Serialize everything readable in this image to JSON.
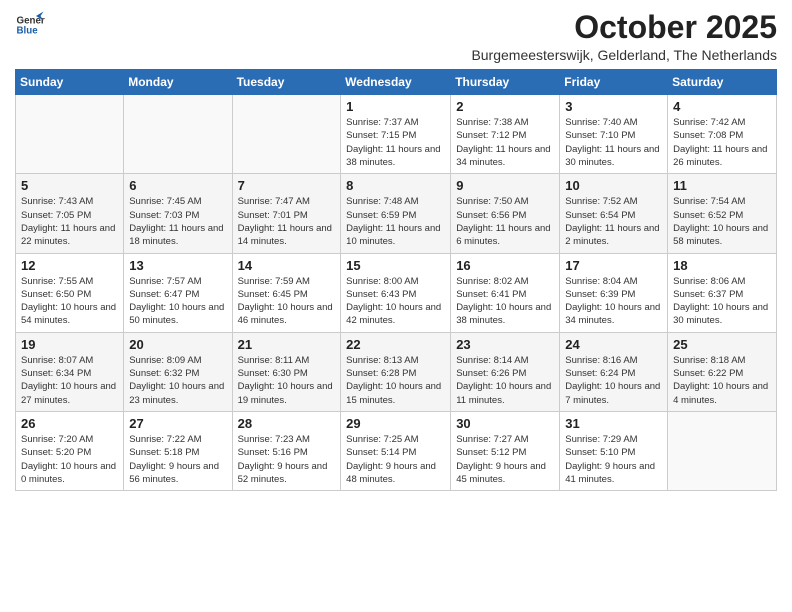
{
  "logo": {
    "line1": "General",
    "line2": "Blue"
  },
  "title": "October 2025",
  "subtitle": "Burgemeesterswijk, Gelderland, The Netherlands",
  "days_of_week": [
    "Sunday",
    "Monday",
    "Tuesday",
    "Wednesday",
    "Thursday",
    "Friday",
    "Saturday"
  ],
  "weeks": [
    [
      {
        "day": "",
        "info": ""
      },
      {
        "day": "",
        "info": ""
      },
      {
        "day": "",
        "info": ""
      },
      {
        "day": "1",
        "info": "Sunrise: 7:37 AM\nSunset: 7:15 PM\nDaylight: 11 hours and 38 minutes."
      },
      {
        "day": "2",
        "info": "Sunrise: 7:38 AM\nSunset: 7:12 PM\nDaylight: 11 hours and 34 minutes."
      },
      {
        "day": "3",
        "info": "Sunrise: 7:40 AM\nSunset: 7:10 PM\nDaylight: 11 hours and 30 minutes."
      },
      {
        "day": "4",
        "info": "Sunrise: 7:42 AM\nSunset: 7:08 PM\nDaylight: 11 hours and 26 minutes."
      }
    ],
    [
      {
        "day": "5",
        "info": "Sunrise: 7:43 AM\nSunset: 7:05 PM\nDaylight: 11 hours and 22 minutes."
      },
      {
        "day": "6",
        "info": "Sunrise: 7:45 AM\nSunset: 7:03 PM\nDaylight: 11 hours and 18 minutes."
      },
      {
        "day": "7",
        "info": "Sunrise: 7:47 AM\nSunset: 7:01 PM\nDaylight: 11 hours and 14 minutes."
      },
      {
        "day": "8",
        "info": "Sunrise: 7:48 AM\nSunset: 6:59 PM\nDaylight: 11 hours and 10 minutes."
      },
      {
        "day": "9",
        "info": "Sunrise: 7:50 AM\nSunset: 6:56 PM\nDaylight: 11 hours and 6 minutes."
      },
      {
        "day": "10",
        "info": "Sunrise: 7:52 AM\nSunset: 6:54 PM\nDaylight: 11 hours and 2 minutes."
      },
      {
        "day": "11",
        "info": "Sunrise: 7:54 AM\nSunset: 6:52 PM\nDaylight: 10 hours and 58 minutes."
      }
    ],
    [
      {
        "day": "12",
        "info": "Sunrise: 7:55 AM\nSunset: 6:50 PM\nDaylight: 10 hours and 54 minutes."
      },
      {
        "day": "13",
        "info": "Sunrise: 7:57 AM\nSunset: 6:47 PM\nDaylight: 10 hours and 50 minutes."
      },
      {
        "day": "14",
        "info": "Sunrise: 7:59 AM\nSunset: 6:45 PM\nDaylight: 10 hours and 46 minutes."
      },
      {
        "day": "15",
        "info": "Sunrise: 8:00 AM\nSunset: 6:43 PM\nDaylight: 10 hours and 42 minutes."
      },
      {
        "day": "16",
        "info": "Sunrise: 8:02 AM\nSunset: 6:41 PM\nDaylight: 10 hours and 38 minutes."
      },
      {
        "day": "17",
        "info": "Sunrise: 8:04 AM\nSunset: 6:39 PM\nDaylight: 10 hours and 34 minutes."
      },
      {
        "day": "18",
        "info": "Sunrise: 8:06 AM\nSunset: 6:37 PM\nDaylight: 10 hours and 30 minutes."
      }
    ],
    [
      {
        "day": "19",
        "info": "Sunrise: 8:07 AM\nSunset: 6:34 PM\nDaylight: 10 hours and 27 minutes."
      },
      {
        "day": "20",
        "info": "Sunrise: 8:09 AM\nSunset: 6:32 PM\nDaylight: 10 hours and 23 minutes."
      },
      {
        "day": "21",
        "info": "Sunrise: 8:11 AM\nSunset: 6:30 PM\nDaylight: 10 hours and 19 minutes."
      },
      {
        "day": "22",
        "info": "Sunrise: 8:13 AM\nSunset: 6:28 PM\nDaylight: 10 hours and 15 minutes."
      },
      {
        "day": "23",
        "info": "Sunrise: 8:14 AM\nSunset: 6:26 PM\nDaylight: 10 hours and 11 minutes."
      },
      {
        "day": "24",
        "info": "Sunrise: 8:16 AM\nSunset: 6:24 PM\nDaylight: 10 hours and 7 minutes."
      },
      {
        "day": "25",
        "info": "Sunrise: 8:18 AM\nSunset: 6:22 PM\nDaylight: 10 hours and 4 minutes."
      }
    ],
    [
      {
        "day": "26",
        "info": "Sunrise: 7:20 AM\nSunset: 5:20 PM\nDaylight: 10 hours and 0 minutes."
      },
      {
        "day": "27",
        "info": "Sunrise: 7:22 AM\nSunset: 5:18 PM\nDaylight: 9 hours and 56 minutes."
      },
      {
        "day": "28",
        "info": "Sunrise: 7:23 AM\nSunset: 5:16 PM\nDaylight: 9 hours and 52 minutes."
      },
      {
        "day": "29",
        "info": "Sunrise: 7:25 AM\nSunset: 5:14 PM\nDaylight: 9 hours and 48 minutes."
      },
      {
        "day": "30",
        "info": "Sunrise: 7:27 AM\nSunset: 5:12 PM\nDaylight: 9 hours and 45 minutes."
      },
      {
        "day": "31",
        "info": "Sunrise: 7:29 AM\nSunset: 5:10 PM\nDaylight: 9 hours and 41 minutes."
      },
      {
        "day": "",
        "info": ""
      }
    ]
  ]
}
